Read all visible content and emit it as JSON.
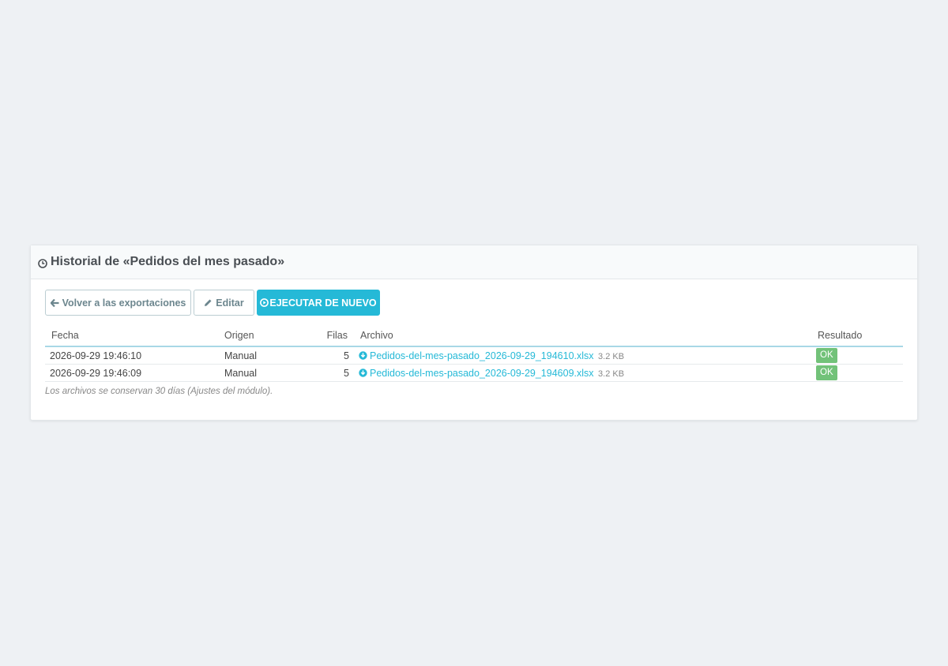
{
  "panel": {
    "title": "Historial de «Pedidos del mes pasado»",
    "title_icon": "clock-icon"
  },
  "toolbar": {
    "back_label": "Volver a las exportaciones",
    "back_icon": "arrow-left-icon",
    "edit_label": "Editar",
    "edit_icon": "pencil-icon",
    "run_label": "EJECUTAR DE NUEVO",
    "run_icon": "play-circle-icon"
  },
  "table": {
    "headers": {
      "fecha": "Fecha",
      "origen": "Origen",
      "filas": "Filas",
      "archivo": "Archivo",
      "resultado": "Resultado"
    },
    "rows": [
      {
        "fecha": "2026-09-29 19:46:10",
        "origen": "Manual",
        "filas": "5",
        "archivo": "Pedidos-del-mes-pasado_2026-09-29_194610.xlsx",
        "size": "3.2 KB",
        "resultado": "OK"
      },
      {
        "fecha": "2026-09-29 19:46:09",
        "origen": "Manual",
        "filas": "5",
        "archivo": "Pedidos-del-mes-pasado_2026-09-29_194609.xlsx",
        "size": "3.2 KB",
        "resultado": "OK"
      }
    ]
  },
  "note": "Los archivos se conservan 30 días (Ajustes del módulo).",
  "colors": {
    "accent": "#25b9d7",
    "success": "#72c279",
    "background": "#eef1f4"
  }
}
